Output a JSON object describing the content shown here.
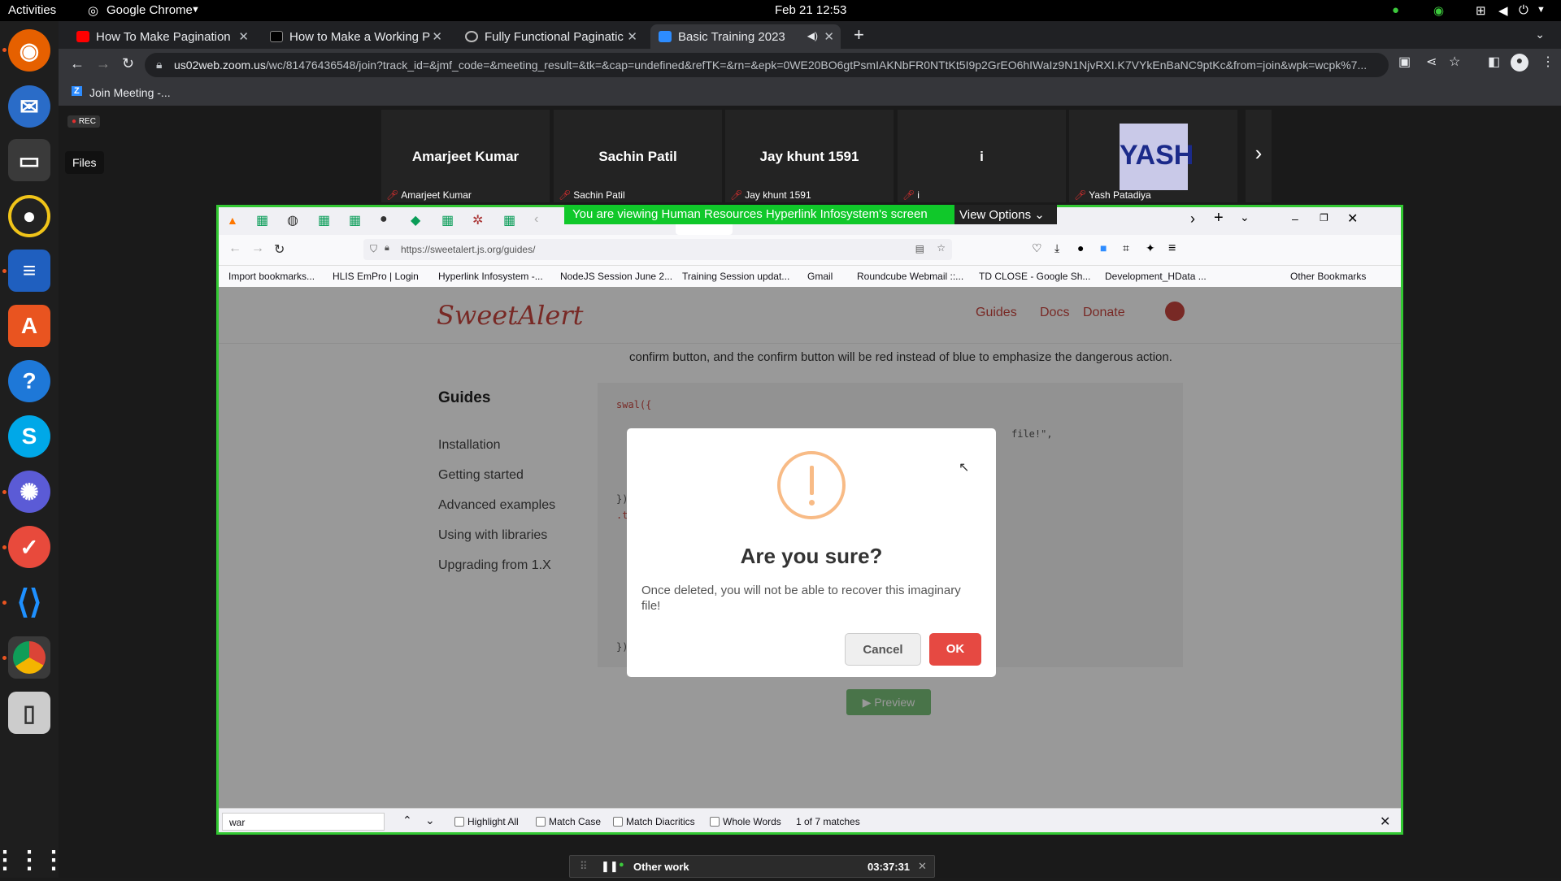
{
  "topbar": {
    "activities": "Activities",
    "app": "Google Chrome",
    "clock": "Feb 21  12:53"
  },
  "dock": {
    "tooltip": "Files"
  },
  "chrome": {
    "tabs": [
      {
        "title": "How To Make Pagination"
      },
      {
        "title": "How to Make a Working P"
      },
      {
        "title": "Fully Functional Paginatic"
      },
      {
        "title": "Basic Training 2023"
      }
    ],
    "url_host": "us02web.zoom.us",
    "url_rest": "/wc/81476436548/join?track_id=&jmf_code=&meeting_result=&tk=&cap=undefined&refTK=&rn=&epk=0WE20BO6gtPsmIAKNbFR0NTtKt5I9p2GrEO6hIWaIz9N1NjvRXI.K7VYkEnBaNC9ptKc&from=join&wpk=wcpk%7...",
    "bookmark": "Join Meeting -..."
  },
  "zoom": {
    "rec": "REC",
    "participants": [
      {
        "name": "Amarjeet Kumar",
        "label": "Amarjeet Kumar"
      },
      {
        "name": "Sachin Patil",
        "label": "Sachin Patil"
      },
      {
        "name": "Jay khunt 1591",
        "label": "Jay khunt 1591"
      },
      {
        "name": "i",
        "label": "i"
      },
      {
        "name": "YASH",
        "label": "Yash Patadiya"
      }
    ],
    "banner": "You are viewing Human Resources Hyperlink Infosystem's screen",
    "view_options": "View Options",
    "timer": {
      "label": "Other work",
      "time": "03:37:31"
    }
  },
  "firefox": {
    "url": "https://sweetalert.js.org/guides/",
    "bookmarks": [
      "Import bookmarks...",
      "HLIS EmPro | Login",
      "Hyperlink Infosystem -...",
      "NodeJS Session June 2...",
      "Training Session updat...",
      "Gmail",
      "Roundcube Webmail ::...",
      "TD CLOSE - Google Sh...",
      "Development_HData ..."
    ],
    "other_bookmarks": "Other Bookmarks",
    "find": {
      "query": "war",
      "highlight_all": "Highlight All",
      "match_case": "Match Case",
      "match_diacritics": "Match Diacritics",
      "whole_words": "Whole Words",
      "status": "1 of 7 matches"
    }
  },
  "page": {
    "logo": "SweetAlert",
    "nav": [
      "Guides",
      "Docs",
      "Donate"
    ],
    "intro": "confirm button, and the confirm button will be red instead of blue to emphasize the dangerous action.",
    "sidebar_title": "Guides",
    "sidebar": [
      "Installation",
      "Getting started",
      "Advanced examples",
      "Using with libraries",
      "Upgrading from 1.X"
    ],
    "code_start": "swal({",
    "code_frag": "file!\",",
    "code_end": "})",
    "code_close": "})",
    "code_dot": ".t",
    "preview": "▶ Preview"
  },
  "modal": {
    "title": "Are you sure?",
    "text": "Once deleted, you will not be able to recover this imaginary file!",
    "cancel": "Cancel",
    "ok": "OK"
  }
}
